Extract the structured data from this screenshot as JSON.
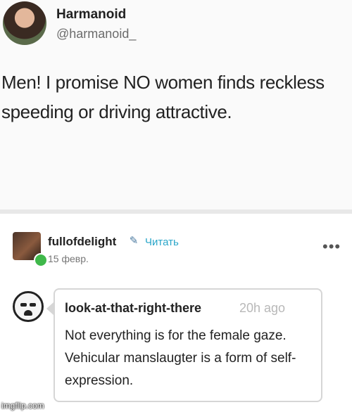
{
  "tweet": {
    "display_name": "Harmanoid",
    "handle": "@harmanoid_",
    "text": "Men! I promise NO women finds reckless speeding or driving attractive."
  },
  "post": {
    "username": "fullofdelight",
    "follow_label": "Читать",
    "date": "15 февр.",
    "more_label": "•••"
  },
  "quote": {
    "username": "look-at-that-right-there",
    "time": "20h ago",
    "text": "Not everything is for the female gaze. Vehicular manslaugter is a form of self-expression."
  },
  "watermark": "imgflip.com"
}
